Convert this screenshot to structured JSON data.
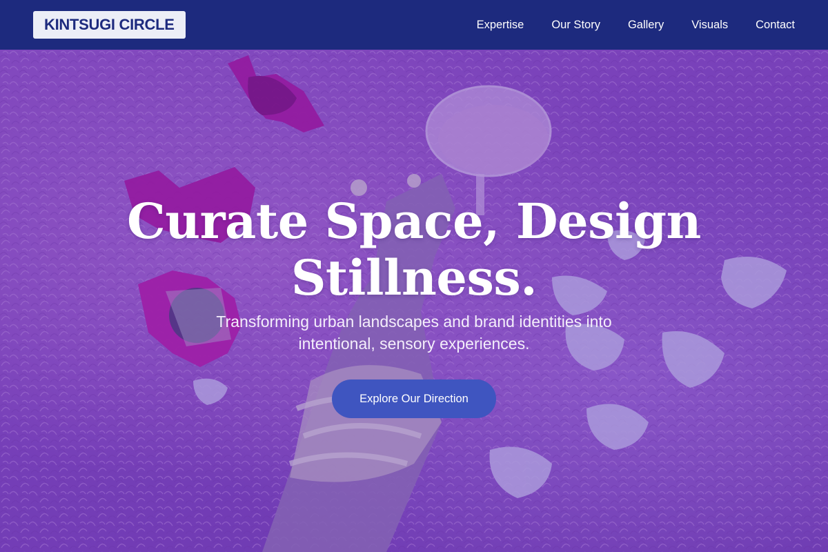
{
  "brand": {
    "logo_text": "KINTSUGI CIRCLE"
  },
  "nav": {
    "items": [
      {
        "label": "Expertise"
      },
      {
        "label": "Our Story"
      },
      {
        "label": "Gallery"
      },
      {
        "label": "Visuals"
      },
      {
        "label": "Contact"
      }
    ]
  },
  "hero": {
    "title": "Curate Space, Design Stillness.",
    "subtitle": "Transforming urban landscapes and brand identities into intentional, sensory experiences.",
    "cta_label": "Explore Our Direction"
  },
  "colors": {
    "navbar_bg": "#1d2a7e",
    "logo_bg": "#eceef7",
    "cta_bg": "#3f55c0",
    "hero_tint": "#8a49bf"
  }
}
